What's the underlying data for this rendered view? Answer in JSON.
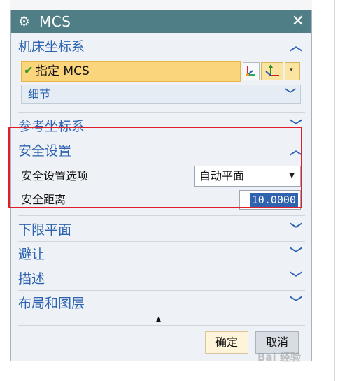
{
  "window": {
    "title": "MCS",
    "title_icon": "gear-icon",
    "close_icon": "close-icon"
  },
  "sections": {
    "machine_csys": {
      "title": "机床坐标系",
      "specify_label": "指定 MCS",
      "detail_label": "细节"
    },
    "reference_csys": {
      "title": "参考坐标系"
    },
    "clearance": {
      "title": "安全设置",
      "option_label": "安全设置选项",
      "option_value": "自动平面",
      "distance_label": "安全距离",
      "distance_value": "10.0000"
    },
    "lower_limit": {
      "title": "下限平面"
    },
    "avoidance": {
      "title": "避让"
    },
    "description": {
      "title": "描述"
    },
    "layout_layers": {
      "title": "布局和图层"
    }
  },
  "buttons": {
    "ok": "确定",
    "cancel": "取消"
  },
  "watermark": "Bai 经验",
  "colors": {
    "titlebar": "#4f7e86",
    "section_text": "#2d63b0",
    "highlight": "#e01e2b",
    "selected_row": "#fbd57c"
  }
}
